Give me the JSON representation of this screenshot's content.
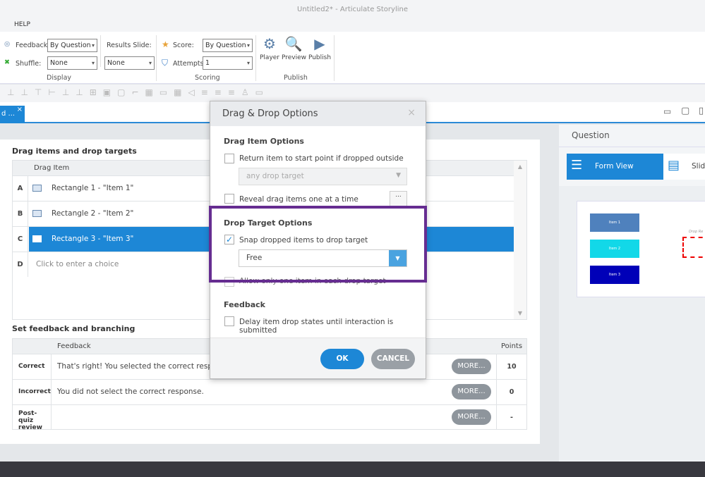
{
  "window": {
    "title": "Untitled2* -  Articulate Storyline"
  },
  "menu": {
    "help": "HELP"
  },
  "ribbon": {
    "feedback_label": "Feedback:",
    "feedback_value": "By Question",
    "shuffle_label": "Shuffle:",
    "shuffle_value": "None",
    "results_label": "Results Slide:",
    "results_value": "None",
    "display_group": "Display",
    "score_label": "Score:",
    "score_value": "By Question",
    "attempts_label": "Attempts:",
    "attempts_value": "1",
    "scoring_group": "Scoring",
    "player": "Player",
    "preview": "Preview",
    "publish": "Publish",
    "publish_group": "Publish"
  },
  "tab": {
    "label": "d ...",
    "close": "×"
  },
  "drag": {
    "title": "Drag items and drop targets",
    "column": "Drag Item",
    "rows": [
      {
        "key": "A",
        "label": "Rectangle 1 - \"Item 1\""
      },
      {
        "key": "B",
        "label": "Rectangle 2 - \"Item 2\""
      },
      {
        "key": "C",
        "label": "Rectangle 3 - \"Item 3\""
      },
      {
        "key": "D",
        "label": "Click to enter a choice"
      }
    ]
  },
  "feedback": {
    "title": "Set feedback and branching",
    "col_feedback": "Feedback",
    "col_points": "Points",
    "rows": [
      {
        "type": "Correct",
        "text": "That's right!  You selected the correct response.",
        "more": "MORE...",
        "points": "10"
      },
      {
        "type": "Incorrect",
        "text": "You did not select the correct response.",
        "more": "MORE...",
        "points": "0"
      },
      {
        "type": "Post-quiz review",
        "text": "",
        "more": "MORE...",
        "points": "-"
      }
    ]
  },
  "right": {
    "title": "Question",
    "form_view": "Form View",
    "slide_view": "Slide",
    "items": [
      "Item 1",
      "Item 2",
      "Item 3"
    ],
    "drop_label": "Drop Re"
  },
  "dialog": {
    "title": "Drag & Drop Options",
    "close": "×",
    "drag_item_heading": "Drag Item Options",
    "return_item": "Return item to start point if dropped outside",
    "return_select": "any drop target",
    "reveal": "Reveal drag items one at a time",
    "reveal_btn": "...",
    "drop_target_heading": "Drop Target Options",
    "snap": "Snap dropped items to drop target",
    "snap_select": "Free",
    "allow_one": "Allow only one item in each drop target",
    "feedback_heading": "Feedback",
    "delay": "Delay item drop states until interaction is submitted",
    "ok": "OK",
    "cancel": "CANCEL"
  },
  "colors": {
    "accent": "#1d87d6",
    "highlight": "#662d91"
  }
}
